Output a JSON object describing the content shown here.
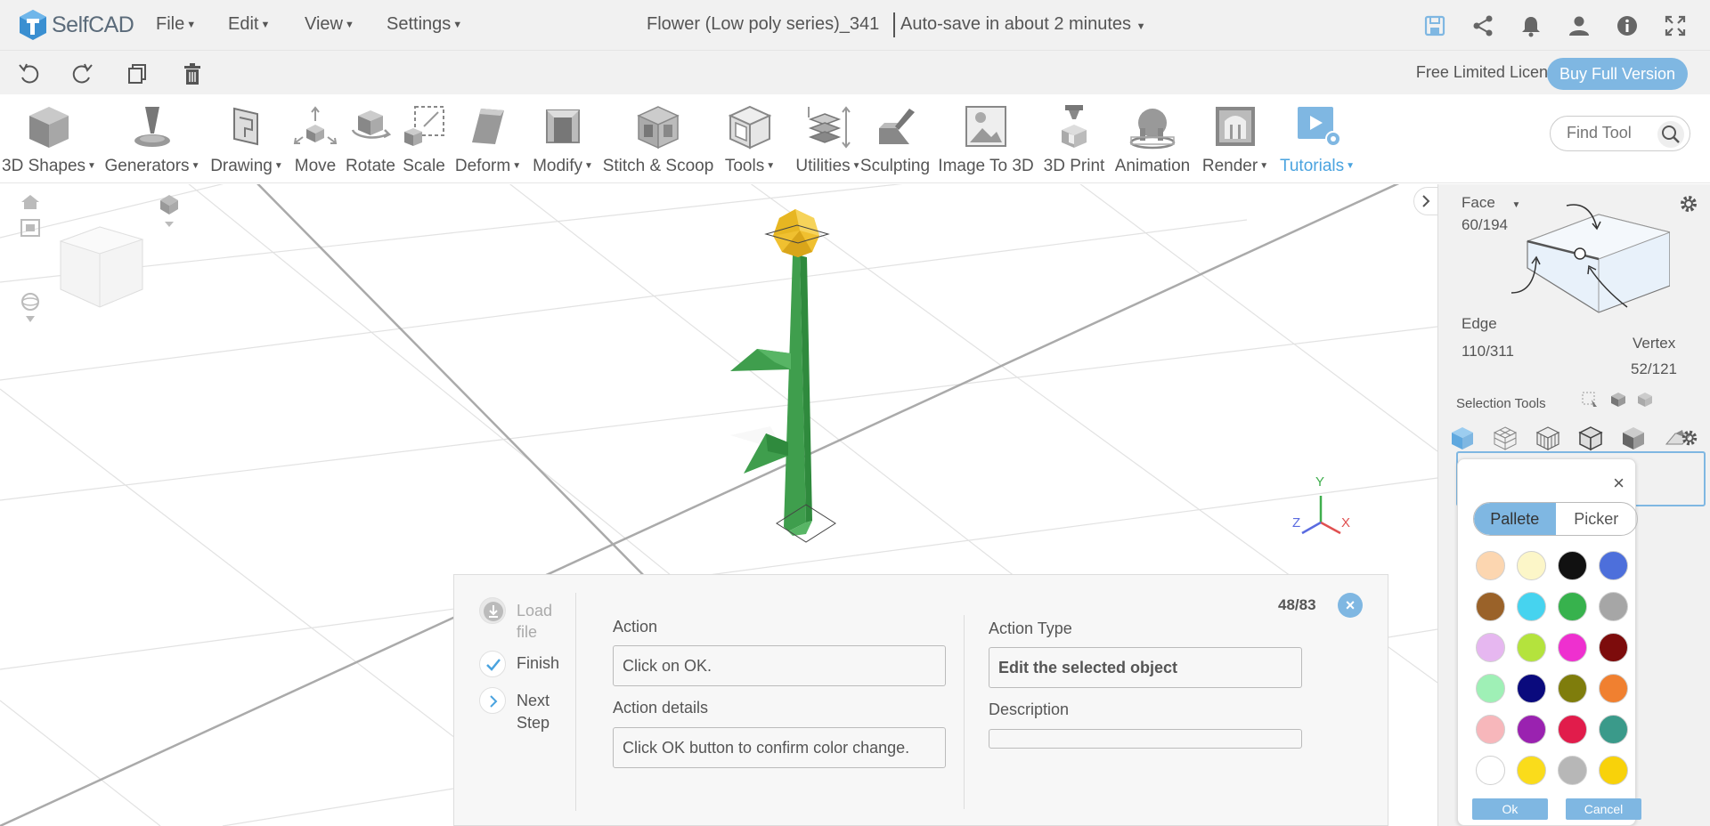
{
  "app": {
    "logo_text": "SelfCAD"
  },
  "menu": [
    {
      "label": "File"
    },
    {
      "label": "Edit"
    },
    {
      "label": "View"
    },
    {
      "label": "Settings"
    }
  ],
  "document": {
    "title": "Flower (Low poly series)_341",
    "autosave": "Auto-save in about 2 minutes"
  },
  "header_icons": [
    "save-icon",
    "share-icon",
    "bell-icon",
    "user-icon",
    "info-icon",
    "fullscreen-icon"
  ],
  "subbar": {
    "icons": [
      "undo-icon",
      "redo-icon",
      "copy-icon",
      "delete-icon"
    ],
    "license": "Free Limited License",
    "buy_label": "Buy Full Version"
  },
  "toolbar": {
    "tools": [
      {
        "label": "3D Shapes",
        "dropdown": true
      },
      {
        "label": "Generators",
        "dropdown": true
      },
      {
        "label": "Drawing",
        "dropdown": true
      },
      {
        "label": "Move",
        "dropdown": false
      },
      {
        "label": "Rotate",
        "dropdown": false
      },
      {
        "label": "Scale",
        "dropdown": false
      },
      {
        "label": "Deform",
        "dropdown": true
      },
      {
        "label": "Modify",
        "dropdown": true
      },
      {
        "label": "Stitch & Scoop",
        "dropdown": false
      },
      {
        "label": "Tools",
        "dropdown": true
      },
      {
        "label": "Utilities",
        "dropdown": true
      },
      {
        "label": "Sculpting",
        "dropdown": false
      },
      {
        "label": "Image To 3D",
        "dropdown": false
      },
      {
        "label": "3D Print",
        "dropdown": false
      },
      {
        "label": "Animation",
        "dropdown": false
      },
      {
        "label": "Render",
        "dropdown": true
      },
      {
        "label": "Tutorials",
        "dropdown": true,
        "active": true
      }
    ],
    "find_placeholder": "Find Tool"
  },
  "viewport": {
    "axes": {
      "x": "X",
      "y": "Y",
      "z": "Z"
    }
  },
  "selection_panel": {
    "face_label": "Face",
    "face_count": "60/194",
    "edge_label": "Edge",
    "edge_count": "110/311",
    "vertex_label": "Vertex",
    "vertex_count": "52/121",
    "selection_tools_label": "Selection Tools"
  },
  "color_picker": {
    "tab_palette": "Pallete",
    "tab_picker": "Picker",
    "close_symbol": "×",
    "swatches": [
      "#fcd6b0",
      "#fcf6c8",
      "#111111",
      "#4d6fdb",
      "#9a6229",
      "#46d3ef",
      "#37b24d",
      "#a6a6a6",
      "#e6b7f0",
      "#b4e33d",
      "#ee30cf",
      "#7d0c0c",
      "#9ff0b6",
      "#0a0a7d",
      "#7f7d0c",
      "#f08030",
      "#f7b7bb",
      "#9a22b0",
      "#e11c4b",
      "#3a9a8a",
      "#ffffff",
      "#fadc1b",
      "#b7b7b7",
      "#f8d20a"
    ],
    "ok_label": "Ok",
    "cancel_label": "Cancel"
  },
  "action_panel": {
    "steps": [
      {
        "label": "Load file"
      },
      {
        "label": "Finish"
      },
      {
        "label": "Next Step"
      }
    ],
    "counter": "48/83",
    "action_label": "Action",
    "action_value": "Click on OK.",
    "details_label": "Action details",
    "details_value": "Click OK button to confirm color change.",
    "type_label": "Action Type",
    "type_value": "Edit the selected object",
    "description_label": "Description",
    "description_value": ""
  },
  "colors": {
    "accent": "#7fb7e2",
    "tutorials_blue": "#4aa3df",
    "stem_green": "#3f9e4d",
    "flower_yellow": "#f0c030"
  }
}
